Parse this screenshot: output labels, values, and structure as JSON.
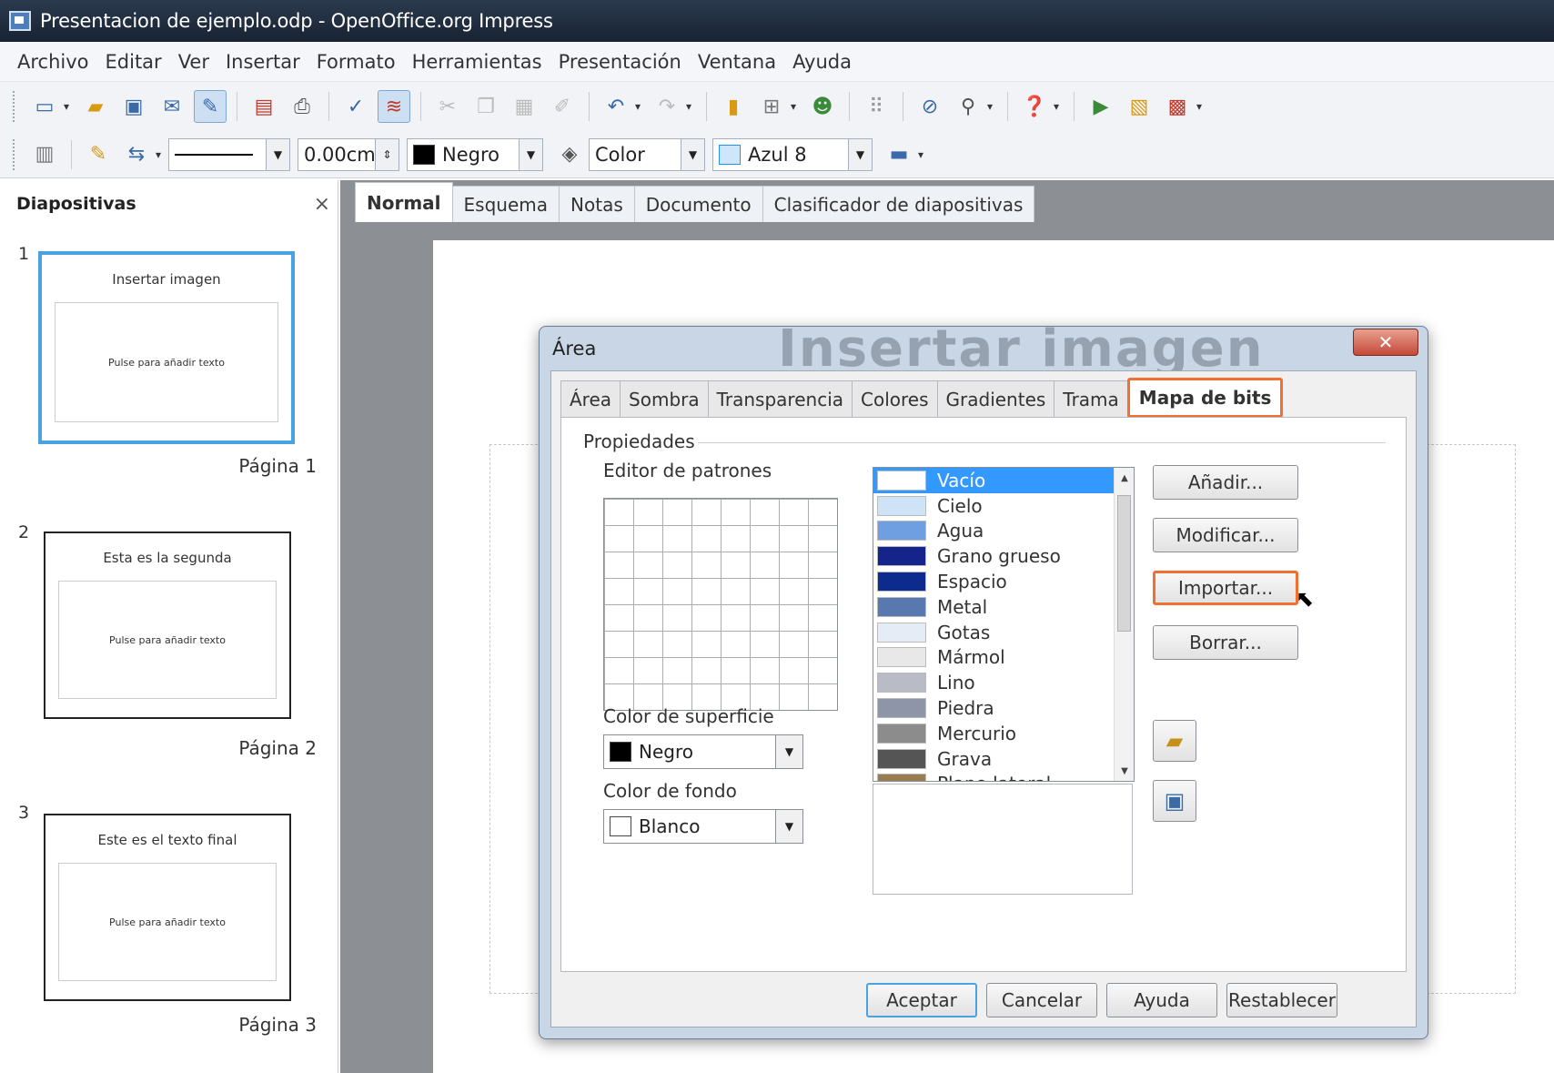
{
  "window": {
    "title": "Presentacion de ejemplo.odp - OpenOffice.org Impress"
  },
  "menu": [
    "Archivo",
    "Editar",
    "Ver",
    "Insertar",
    "Formato",
    "Herramientas",
    "Presentación",
    "Ventana",
    "Ayuda"
  ],
  "toolbar2": {
    "line_width": "0.00cm",
    "line_color": "Negro",
    "fill_type": "Color",
    "fill_color": "Azul 8",
    "colors": {
      "negro": "#000000",
      "azul8": "#1e90ff"
    }
  },
  "slides_pane": {
    "title": "Diapositivas",
    "close": "×",
    "slides": [
      {
        "num": "1",
        "title": "Insertar imagen",
        "body": "Pulse para añadir texto",
        "label": "Página 1"
      },
      {
        "num": "2",
        "title": "Esta es la segunda",
        "body": "Pulse para añadir texto",
        "label": "Página 2"
      },
      {
        "num": "3",
        "title": "Este es el texto final",
        "body": "Pulse para añadir texto",
        "label": "Página 3"
      }
    ]
  },
  "view_tabs": [
    "Normal",
    "Esquema",
    "Notas",
    "Documento",
    "Clasificador de diapositivas"
  ],
  "dialog": {
    "title": "Área",
    "watermark": "Insertar imagen",
    "close": "✕",
    "tabs": [
      "Área",
      "Sombra",
      "Transparencia",
      "Colores",
      "Gradientes",
      "Trama",
      "Mapa de bits"
    ],
    "group": "Propiedades",
    "pattern_editor": "Editor de patrones",
    "surface_color_label": "Color de superficie",
    "surface_color": "Negro",
    "background_color_label": "Color de fondo",
    "background_color": "Blanco",
    "bitmaps": [
      "Vacío",
      "Cielo",
      "Agua",
      "Grano grueso",
      "Espacio",
      "Metal",
      "Gotas",
      "Mármol",
      "Lino",
      "Piedra",
      "Mercurio",
      "Grava",
      "Plano lateral"
    ],
    "bitmap_colors": [
      "#ffffff",
      "#cfe3f6",
      "#6f9fe0",
      "#14248a",
      "#0d2a8e",
      "#5a78b0",
      "#e6ecf6",
      "#e8e8e8",
      "#b9bcc4",
      "#8e95a8",
      "#8c8c8c",
      "#555555",
      "#9b7b52"
    ],
    "buttons": {
      "add": "Añadir...",
      "modify": "Modificar...",
      "import": "Importar...",
      "delete": "Borrar..."
    },
    "footer": {
      "ok": "Aceptar",
      "cancel": "Cancelar",
      "help": "Ayuda",
      "reset": "Restablecer"
    }
  }
}
